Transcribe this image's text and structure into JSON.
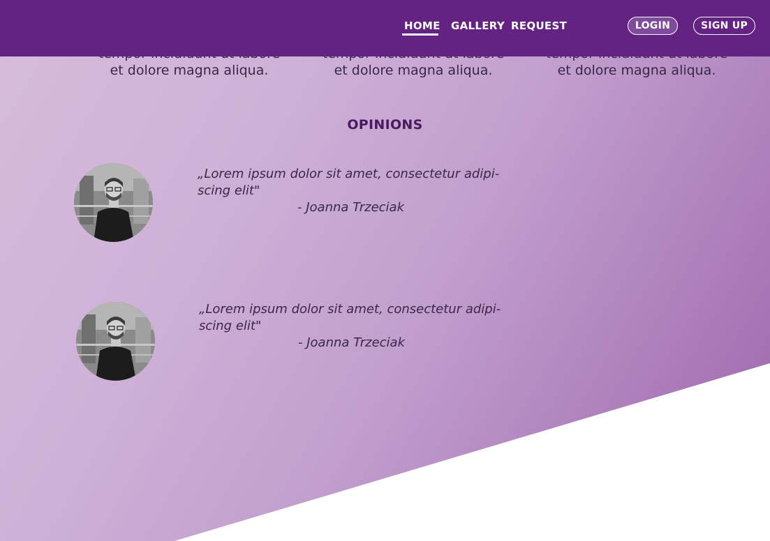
{
  "nav": {
    "links": [
      {
        "label": "HOME",
        "active": true
      },
      {
        "label": "GALLERY",
        "active": false
      },
      {
        "label": "REQUEST",
        "active": false
      }
    ],
    "login_label": "LOGIN",
    "signup_label": "SIGN UP"
  },
  "features": [
    {
      "text_line1": "tempor incididunt ut labore",
      "text_line2": "et dolore magna aliqua."
    },
    {
      "text_line1": "tempor incididunt ut labore",
      "text_line2": "et dolore magna aliqua."
    },
    {
      "text_line1": "tempor incididunt ut labore",
      "text_line2": "et dolore magna aliqua."
    }
  ],
  "opinions": {
    "title": "OPINIONS",
    "items": [
      {
        "quote": "„Lorem ipsum dolor sit amet, consectetur adipi-scing elit\"",
        "author": "- Joanna Trzeciak"
      },
      {
        "quote": "„Lorem ipsum dolor sit amet, consectetur adipi-scing elit\"",
        "author": "- Joanna Trzeciak"
      }
    ]
  },
  "colors": {
    "nav_background": "#642383",
    "heading": "#4a1a5e",
    "text": "#3a2747",
    "gradient_light": "#d6bcdc",
    "gradient_dark": "#9a66ad"
  }
}
